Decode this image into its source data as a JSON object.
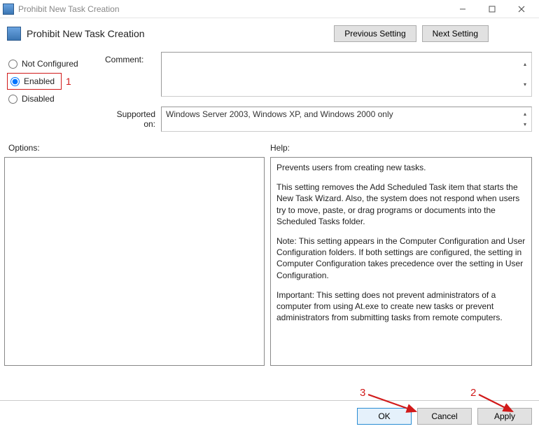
{
  "window": {
    "title": "Prohibit New Task Creation"
  },
  "header": {
    "title": "Prohibit New Task Creation",
    "prev_label": "Previous Setting",
    "next_label": "Next Setting"
  },
  "states": {
    "not_configured": "Not Configured",
    "enabled": "Enabled",
    "disabled": "Disabled",
    "selected": "enabled"
  },
  "comment": {
    "label": "Comment:",
    "value": ""
  },
  "supported": {
    "label": "Supported on:",
    "value": "Windows Server 2003, Windows XP, and Windows 2000 only"
  },
  "panels": {
    "options_label": "Options:",
    "help_label": "Help:"
  },
  "help": {
    "p1": "Prevents users from creating new tasks.",
    "p2": "This setting removes the Add Scheduled Task item that starts the New Task Wizard. Also, the system does not respond when users try to move, paste, or drag programs or documents into the Scheduled Tasks folder.",
    "p3": "Note: This setting appears in the Computer Configuration and User Configuration folders. If both settings are configured, the setting in Computer Configuration takes precedence over the setting in User Configuration.",
    "p4": "Important: This setting does not prevent administrators of a computer from using At.exe to create new tasks or prevent administrators from submitting tasks from remote computers."
  },
  "footer": {
    "ok": "OK",
    "cancel": "Cancel",
    "apply": "Apply"
  },
  "annotations": {
    "n1": "1",
    "n2": "2",
    "n3": "3"
  }
}
